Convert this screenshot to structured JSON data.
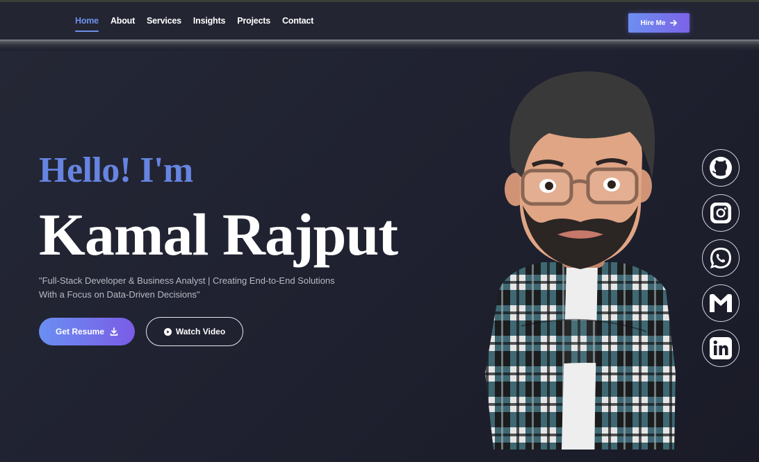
{
  "nav": {
    "links": [
      {
        "label": "Home",
        "active": true
      },
      {
        "label": "About",
        "active": false
      },
      {
        "label": "Services",
        "active": false
      },
      {
        "label": "Insights",
        "active": false
      },
      {
        "label": "Projects",
        "active": false
      },
      {
        "label": "Contact",
        "active": false
      }
    ],
    "hire_label": "Hire Me",
    "hire_icon": "arrow-right-icon"
  },
  "hero": {
    "greeting": "Hello! I'm",
    "name": "Kamal Rajput",
    "tagline_line1": "\"Full-Stack Developer & Business Analyst | Creating End-to-End Solutions",
    "tagline_line2": "With a Focus on Data-Driven Decisions\"",
    "resume_label": "Get Resume",
    "resume_icon": "download-icon",
    "video_label": "Watch Video",
    "video_icon": "play-circle-icon"
  },
  "social": [
    {
      "name": "github-icon"
    },
    {
      "name": "instagram-icon"
    },
    {
      "name": "whatsapp-icon"
    },
    {
      "name": "gmail-icon"
    },
    {
      "name": "linkedin-icon"
    }
  ],
  "colors": {
    "accent": "#6684e0",
    "background": "#1d1e2b",
    "navbar": "#232533",
    "gradient_start": "#6a8ff2",
    "gradient_end": "#7a5ce6"
  }
}
